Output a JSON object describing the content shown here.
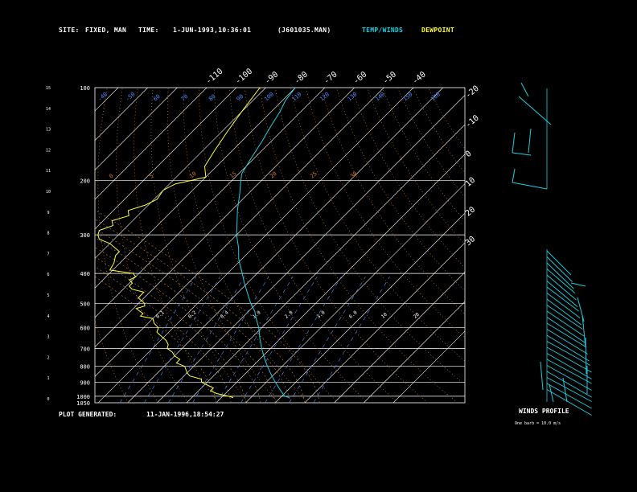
{
  "header": {
    "site_label": "SITE:",
    "site_value": "FIXED, MAN",
    "time_label": "TIME:",
    "time_value": "1-JUN-1993,10:36:01",
    "file_name": "(J601035.MAN)",
    "legend_temp_winds": "TEMP/WINDS",
    "legend_dewpoint": "DEWPOINT"
  },
  "footer": {
    "plot_generated_label": "PLOT GENERATED:",
    "plot_generated_value": "11-JAN-1996,18:54:27",
    "winds_profile_title": "WINDS PROFILE",
    "winds_profile_note": "One barb = 10.0 m/s"
  },
  "colors": {
    "temperature": "#19d0e0",
    "dewpoint": "#ffff33",
    "isotherm": "#ffffff",
    "isobar": "#ffffff",
    "dry_adiabat": "#cc7722",
    "moist_adiabat": "#c08040",
    "mixing_ratio": "#4a8cff",
    "winds": "#19d0e0"
  },
  "chart_data": {
    "type": "line",
    "subtype": "skew-T log-p diagram",
    "pressure_ticks_mb": [
      100,
      200,
      300,
      400,
      500,
      600,
      700,
      800,
      900,
      1000,
      1050
    ],
    "height_ticks_km": [
      0,
      1,
      2,
      3,
      4,
      5,
      6,
      7,
      8,
      9,
      10,
      11,
      12,
      13,
      14,
      15
    ],
    "isotherm_ticks_top_c": [
      -110,
      -100,
      -90,
      -80,
      -70,
      -60,
      -50,
      -40
    ],
    "isotherm_ticks_right_c": [
      -30,
      -20,
      -10,
      0,
      10,
      20,
      30
    ],
    "mixing_ratio_labels": [
      "0.1",
      "0.2",
      "0.4",
      "1.0",
      "2.0",
      "3.0",
      "6.0",
      "10",
      "20"
    ],
    "dry_adiabat_labels": [
      "-40",
      "-50",
      "60",
      "70",
      "80",
      "90",
      "100",
      "110",
      "120",
      "130",
      "140",
      "150",
      "160"
    ],
    "moist_adiabat_labels": [
      "0",
      "5",
      "10",
      "15",
      "20",
      "25",
      "30"
    ],
    "temperature": {
      "pressure_mb": [
        100,
        110,
        120,
        135,
        150,
        170,
        190,
        200,
        220,
        250,
        280,
        300,
        330,
        360,
        400,
        430,
        460,
        500,
        530,
        560,
        600,
        650,
        700,
        750,
        800,
        850,
        900,
        950,
        1000,
        1010
      ],
      "temp_c": [
        -80,
        -79,
        -77,
        -75,
        -73,
        -71,
        -69,
        -67,
        -63,
        -58,
        -53,
        -50,
        -45,
        -41,
        -35,
        -31,
        -27,
        -22,
        -18,
        -15,
        -11,
        -7,
        -3,
        1,
        5,
        9,
        13,
        17,
        21,
        23
      ]
    },
    "dewpoint": {
      "pressure_mb": [
        100,
        120,
        140,
        160,
        180,
        195,
        200,
        205,
        215,
        230,
        240,
        250,
        260,
        270,
        280,
        290,
        300,
        310,
        320,
        340,
        350,
        370,
        390,
        400,
        410,
        420,
        430,
        440,
        450,
        460,
        480,
        500,
        510,
        520,
        530,
        540,
        550,
        560,
        580,
        600,
        620,
        640,
        660,
        680,
        700,
        720,
        740,
        760,
        780,
        800,
        840,
        860,
        880,
        900,
        920,
        940,
        960,
        980,
        1000,
        1010
      ],
      "dewpoint_c": [
        -92,
        -90,
        -88,
        -86,
        -84,
        -80,
        -84,
        -88,
        -90,
        -89,
        -91,
        -95,
        -93,
        -97,
        -95,
        -98,
        -97,
        -95,
        -90,
        -84,
        -84,
        -82,
        -81,
        -72,
        -70,
        -71,
        -69,
        -69,
        -67,
        -62,
        -62,
        -58,
        -57,
        -59,
        -57,
        -55,
        -55,
        -50,
        -48,
        -45,
        -44,
        -41,
        -38,
        -36,
        -35,
        -32,
        -30,
        -27,
        -27,
        -23,
        -20,
        -18,
        -13,
        -12,
        -9,
        -6,
        -6,
        -3,
        2,
        4
      ]
    },
    "winds_profile": {
      "units": "m/s",
      "barb_value": 10.0
    }
  }
}
